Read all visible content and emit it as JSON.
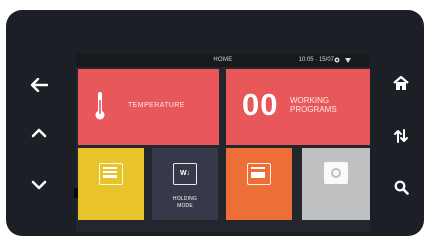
{
  "status": {
    "title": "HOME",
    "time": "10:05 · 15/07",
    "icons": [
      "settings-icon",
      "wifi-icon"
    ]
  },
  "nav_left": [
    "back-arrow-icon",
    "chevron-up-icon",
    "chevron-down-icon"
  ],
  "nav_right": [
    "home-icon",
    "swap-arrows-icon",
    "search-icon"
  ],
  "tiles": {
    "temperature": {
      "label": "TEMPERATURE",
      "icon": "thermometer-icon"
    },
    "programs": {
      "count": "00",
      "line1": "WORKING",
      "line2": "PROGRAMS"
    },
    "a": {
      "icon_text": "",
      "line1": "",
      "line2": "",
      "color": "#e8c32a"
    },
    "b": {
      "icon_text": "W↓",
      "line1": "HOLDING",
      "line2": "MODE",
      "color": "#353949"
    },
    "c": {
      "icon_text": "",
      "line1": "",
      "line2": "",
      "color": "#ee6e37"
    },
    "d": {
      "icon_text": "",
      "line1": "",
      "line2": "",
      "color": "#bfc0c1"
    }
  },
  "colors": {
    "accent_red": "#e8575a",
    "yellow": "#e8c32a",
    "navy": "#353949",
    "orange": "#ee6e37",
    "gray": "#bfc0c1",
    "bezel": "#1c1f26"
  }
}
